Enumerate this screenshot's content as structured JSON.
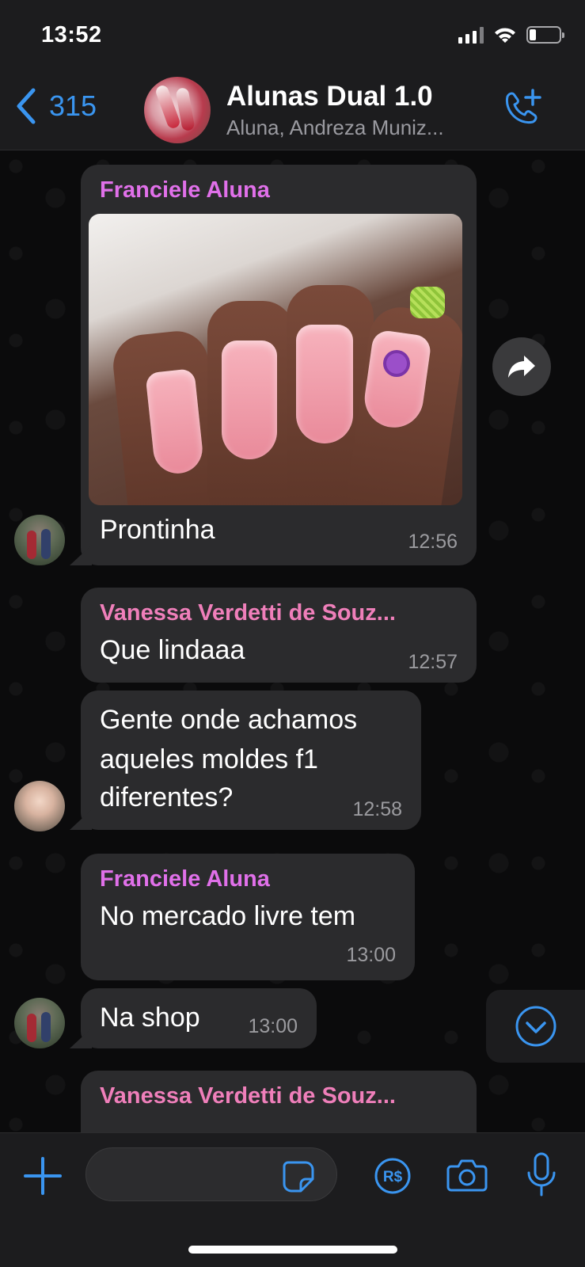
{
  "status": {
    "time": "13:52"
  },
  "header": {
    "back_count": "315",
    "title": "Alunas Dual 1.0",
    "subtitle": "Aluna, Andreza Muniz..."
  },
  "messages": [
    {
      "sender": "Franciele Aluna",
      "text": "Prontinha",
      "time": "12:56",
      "sender_color": "#e070e9"
    },
    {
      "sender": "Vanessa Verdetti de Souz...",
      "text": "Que lindaaa",
      "time": "12:57",
      "sender_color": "#ef7fba"
    },
    {
      "text_lines": [
        "Gente onde achamos",
        "aqueles moldes f1",
        "diferentes?"
      ],
      "time": "12:58"
    },
    {
      "sender": "Franciele Aluna",
      "text": "No mercado livre tem",
      "time": "13:00",
      "sender_color": "#e070e9"
    },
    {
      "text": "Na shop",
      "time": "13:00"
    },
    {
      "sender": "Vanessa Verdetti de Souz...",
      "sender_color": "#ef7fba"
    }
  ],
  "colors": {
    "accent": "#3a95f0",
    "bubble": "#2b2b2d",
    "background": "#0b0b0c"
  },
  "icons": {
    "back": "chevron-left-icon",
    "call_add": "phone-plus-icon",
    "forward": "forward-icon",
    "scroll_down": "chevron-down-circle-icon",
    "attach": "plus-icon",
    "sticker": "sticker-icon",
    "payment": "real-currency-icon",
    "camera": "camera-icon",
    "mic": "microphone-icon"
  }
}
